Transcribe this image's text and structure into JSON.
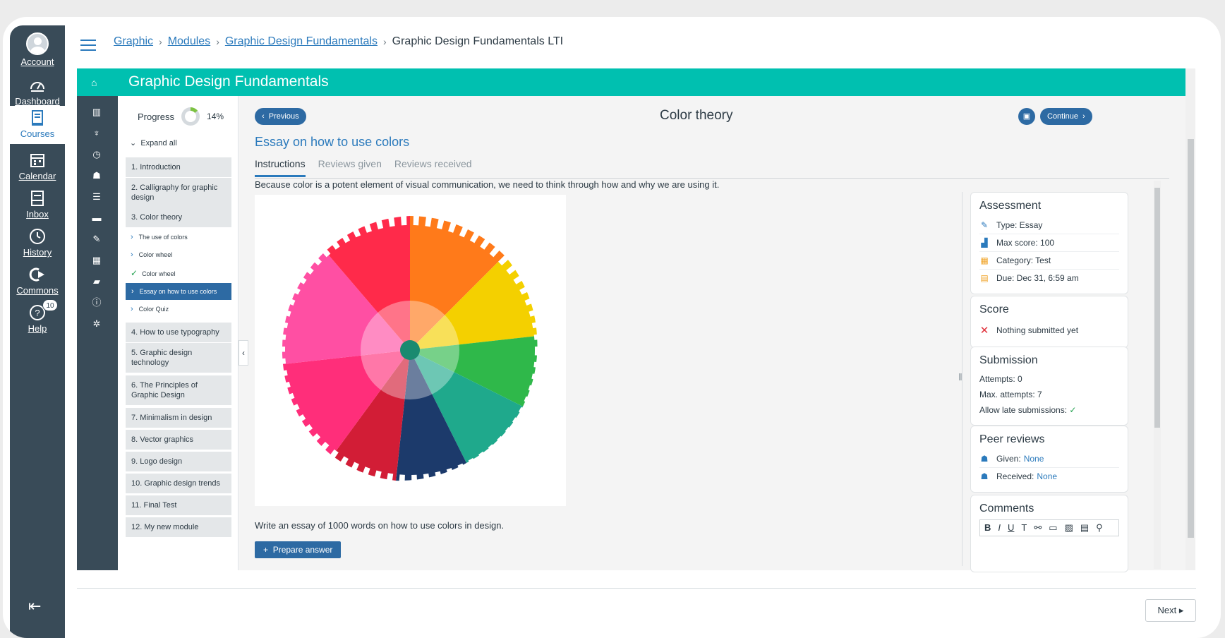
{
  "rail": {
    "items": [
      {
        "label": "Account"
      },
      {
        "label": "Dashboard"
      },
      {
        "label": "Courses"
      },
      {
        "label": "Calendar"
      },
      {
        "label": "Inbox"
      },
      {
        "label": "History"
      },
      {
        "label": "Commons"
      },
      {
        "label": "Help",
        "badge": "10"
      }
    ]
  },
  "breadcrumb": {
    "items": [
      "Graphic",
      "Modules",
      "Graphic Design Fundamentals"
    ],
    "current": "Graphic Design Fundamentals LTI"
  },
  "banner": {
    "title": "Graphic Design Fundamentals"
  },
  "sidebar": {
    "progress_label": "Progress",
    "progress_value": "14%",
    "expand_all": "Expand all",
    "modules": [
      "1. Introduction",
      "2. Calligraphy for graphic design",
      "3. Color theory",
      "4. How to use typography",
      "5. Graphic design technology",
      "6. The Principles of Graphic Design",
      "7. Minimalism in design",
      "8. Vector graphics",
      "9. Logo design",
      "10. Graphic design trends",
      "11. Final Test",
      "12. My new module"
    ],
    "subitems": [
      "The use of colors",
      "Color wheel",
      "Color wheel",
      "Essay on how to use colors",
      "Color Quiz"
    ]
  },
  "content": {
    "previous": "Previous",
    "page_title": "Color theory",
    "continue": "Continue",
    "heading": "Essay on how to use colors",
    "tabs": [
      "Instructions",
      "Reviews given",
      "Reviews received"
    ],
    "intro": "Because color is a potent element of visual communication, we need to think through how and why we are using it.",
    "prompt": "Write an essay of 1000 words on how to use colors in design.",
    "prepare": "Prepare answer"
  },
  "assessment": {
    "title": "Assessment",
    "type": "Type: Essay",
    "max_score": "Max score: 100",
    "category": "Category: Test",
    "due": "Due: Dec 31, 6:59 am"
  },
  "score": {
    "title": "Score",
    "status": "Nothing submitted yet"
  },
  "submission": {
    "title": "Submission",
    "attempts": "Attempts: 0",
    "max_attempts": "Max. attempts: 7",
    "late": "Allow late submissions:"
  },
  "peer": {
    "title": "Peer reviews",
    "given_label": "Given:",
    "given_value": "None",
    "received_label": "Received:",
    "received_value": "None"
  },
  "comments": {
    "title": "Comments"
  },
  "footer": {
    "next": "Next"
  },
  "colors": {
    "teal": "#00c0b0",
    "navy": "#394b58",
    "blue": "#2d6aa3"
  }
}
